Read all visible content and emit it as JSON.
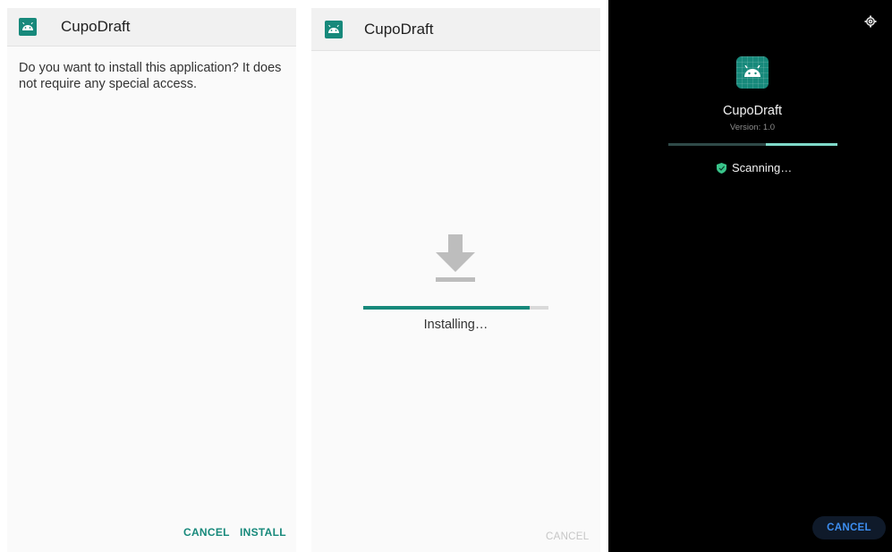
{
  "panel1": {
    "app_title": "CupoDraft",
    "message": "Do you want to install this application? It does not require any special access.",
    "cancel_label": "CANCEL",
    "install_label": "INSTALL"
  },
  "panel2": {
    "app_title": "CupoDraft",
    "status": "Installing…",
    "progress": 0.9,
    "cancel_label": "CANCEL"
  },
  "panel3": {
    "app_name": "CupoDraft",
    "version": "Version: 1.0",
    "status": "Scanning…",
    "cancel_label": "CANCEL"
  },
  "colors": {
    "accent": "#17897b",
    "scan_progress": "#7fd9c9",
    "blue_button": "#3d8ef0"
  }
}
